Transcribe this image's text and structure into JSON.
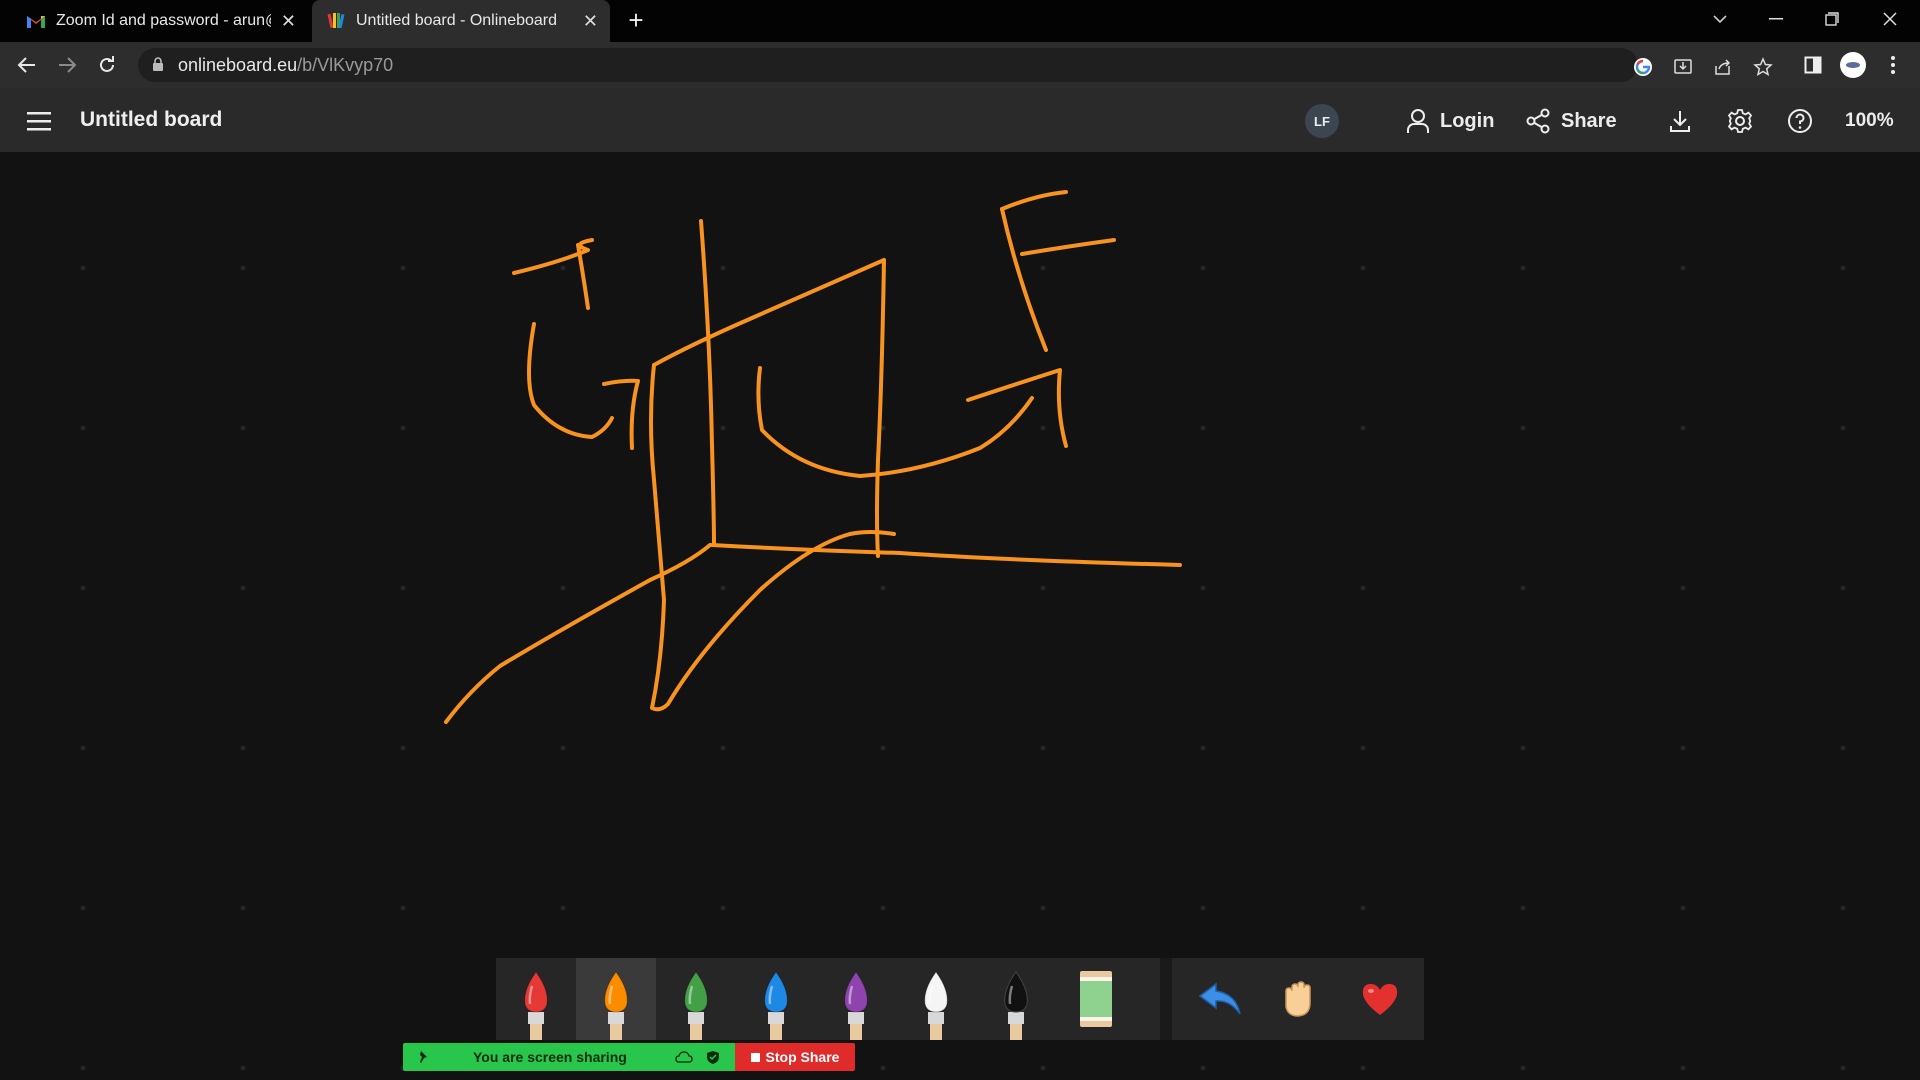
{
  "browser": {
    "tabs": [
      {
        "title": "Zoom Id and password - arun@v",
        "close": "✕",
        "icon": "gmail-icon"
      },
      {
        "title": "Untitled board - Onlineboard",
        "close": "✕",
        "icon": "onlineboard-icon"
      }
    ],
    "new_tab": "+",
    "url_host": "onlineboard.eu",
    "url_path": "/b/VlKvyp70"
  },
  "app": {
    "board_title": "Untitled board",
    "avatar_initials": "LF",
    "login_label": "Login",
    "share_label": "Share",
    "zoom_level": "100%"
  },
  "toolbar": {
    "brushes": [
      {
        "name": "red",
        "color": "#e53935"
      },
      {
        "name": "orange",
        "color": "#fb8c00",
        "selected": true
      },
      {
        "name": "green",
        "color": "#43a047"
      },
      {
        "name": "blue",
        "color": "#1e88e5"
      },
      {
        "name": "purple",
        "color": "#8e44ad"
      },
      {
        "name": "white",
        "color": "#f5f5f5"
      },
      {
        "name": "black",
        "color": "#111111"
      }
    ],
    "eraser_color": "#8fd18f",
    "accent_undo": "#3b8fe6",
    "accent_heart": "#e53030",
    "stroke_color": "#f7931e"
  },
  "screenshare": {
    "status_text": "You are screen sharing",
    "stop_label": "Stop Share"
  }
}
